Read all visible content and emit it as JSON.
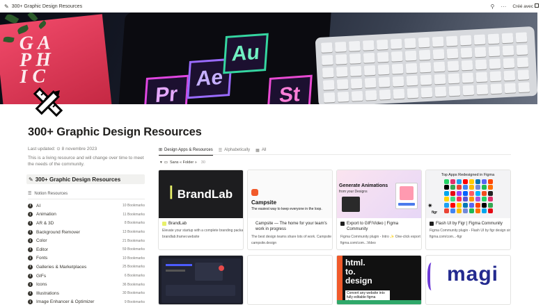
{
  "topbar": {
    "breadcrumb": "300+ Graphic Design Resources",
    "made_with": "Créé avec"
  },
  "cover": {
    "tiles": [
      "Pr",
      "Ae",
      "Au",
      "St"
    ]
  },
  "page": {
    "title": "300+ Graphic Design Resources",
    "updated_label": "Last updated:",
    "updated_date": "8 novembre 2023",
    "description": "This is a living resource and will change over time to meet the needs of the community.",
    "callout": "300+ Graphic Design Resources"
  },
  "resources": {
    "header": "Notion Resources",
    "items": [
      {
        "label": "AI",
        "count": "10 Bookmarks"
      },
      {
        "label": "Animation",
        "count": "11 Bookmarks"
      },
      {
        "label": "AR & 3D",
        "count": "8 Bookmarks"
      },
      {
        "label": "Background Remover",
        "count": "13 Bookmarks"
      },
      {
        "label": "Color",
        "count": "21 Bookmarks"
      },
      {
        "label": "Editor",
        "count": "59 Bookmarks"
      },
      {
        "label": "Fonts",
        "count": "10 Bookmarks"
      },
      {
        "label": "Galleries & Marketplaces",
        "count": "25 Bookmarks"
      },
      {
        "label": "GIFs",
        "count": "6 Bookmarks"
      },
      {
        "label": "Icons",
        "count": "36 Bookmarks"
      },
      {
        "label": "Illustrations",
        "count": "30 Bookmarks"
      },
      {
        "label": "Image Enhancer & Optimizer",
        "count": "9 Bookmarks"
      }
    ]
  },
  "tabs": [
    {
      "label": "Design Apps & Resources",
      "active": true
    },
    {
      "label": "Alphabetically",
      "active": false
    },
    {
      "label": "All",
      "active": false
    }
  ],
  "group": {
    "label": "Sans « Folder »",
    "count": "30"
  },
  "cards": [
    {
      "title": "BrandLab",
      "desc": "Elevate your startup with a complete branding package",
      "url": "brandlab.framer.website",
      "thumb_text": "BrandLab"
    },
    {
      "title": "Campsite — The home for your team's work in progress",
      "desc": "The best design teams share lots of work. Campsite ma",
      "url": "campsite.design",
      "thumb_title": "Campsite",
      "thumb_sub": "The easiest way to keep everyone in the loop."
    },
    {
      "title": "Export to GIF/Video | Figma Community",
      "desc": "Figma Community plugin - Intro ✨ One-click export o",
      "url": "figma.com/com...Video",
      "thumb_title": "Generate Animations",
      "thumb_sub": "from your Designs"
    },
    {
      "title": "Flash UI by Figr | Figma Community",
      "desc": "Figma Community plugin - Flash UI by figr design simp",
      "url": "figma.com/com...-figr",
      "thumb_title": "Top Apps Redesigned in Figma",
      "thumb_brand": "figr"
    }
  ],
  "cards_row2": [
    {
      "thumb_text": ""
    },
    {
      "thumb_text": ""
    },
    {
      "thumb_lines": [
        "html.",
        "to.",
        "design"
      ],
      "thumb_sub": "Convert any website into fully editable figma designs"
    },
    {
      "thumb_text": "magi"
    }
  ]
}
